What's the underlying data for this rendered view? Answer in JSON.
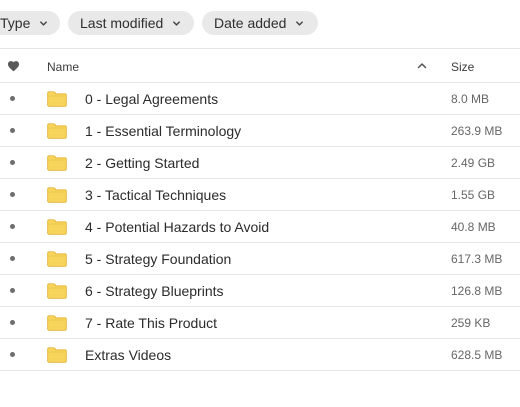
{
  "filters": {
    "type_label": "Type",
    "modified_label": "Last modified",
    "added_label": "Date added"
  },
  "table": {
    "name_header": "Name",
    "size_header": "Size",
    "rows": [
      {
        "name": "0 - Legal Agreements",
        "size": "8.0 MB"
      },
      {
        "name": "1 - Essential Terminology",
        "size": "263.9 MB"
      },
      {
        "name": "2 - Getting Started",
        "size": "2.49 GB"
      },
      {
        "name": "3 - Tactical Techniques",
        "size": "1.55 GB"
      },
      {
        "name": "4 - Potential Hazards to Avoid",
        "size": "40.8 MB"
      },
      {
        "name": "5 - Strategy Foundation",
        "size": "617.3 MB"
      },
      {
        "name": "6 - Strategy Blueprints",
        "size": "126.8 MB"
      },
      {
        "name": "7 - Rate This Product",
        "size": "259 KB"
      },
      {
        "name": "Extras Videos",
        "size": "628.5 MB"
      }
    ]
  },
  "icons": {
    "favorite": "heart-icon",
    "sort": "chevron-up-icon",
    "folder": "folder-icon",
    "dropdown": "chevron-down-icon"
  },
  "colors": {
    "chip_bg": "#e9e9e9",
    "folder_fill": "#f7d55c",
    "folder_stroke": "#e0b22f",
    "divider": "#e6e6e6"
  }
}
